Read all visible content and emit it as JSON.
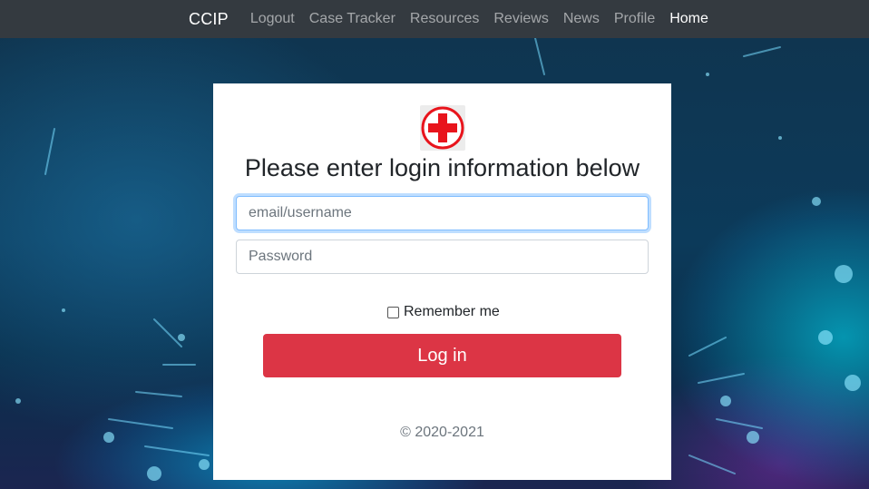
{
  "nav": {
    "brand": "CCIP",
    "links": [
      "Logout",
      "Case Tracker",
      "Resources",
      "Reviews",
      "News",
      "Profile",
      "Home"
    ],
    "active": "Home"
  },
  "login": {
    "logo_icon": "red-cross-icon",
    "title": "Please enter login information below",
    "username_placeholder": "email/username",
    "password_placeholder": "Password",
    "remember_label": "Remember me",
    "remember_checked": false,
    "submit_label": "Log in",
    "footer": "© 2020-2021"
  },
  "colors": {
    "navbar": "#343a40",
    "button": "#dc3545",
    "logo_red": "#e8141c"
  }
}
